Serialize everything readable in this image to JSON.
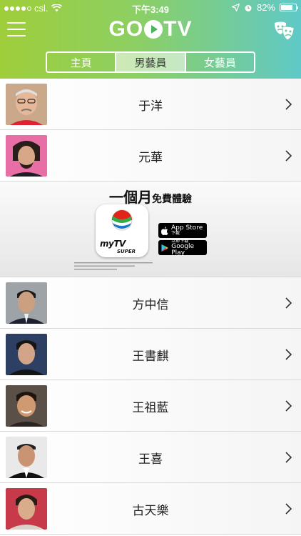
{
  "status_bar": {
    "carrier": "csl.",
    "time": "下午3:49",
    "battery_pct": "82%",
    "battery_level": 0.82
  },
  "nav": {
    "logo_left": "GO",
    "logo_right": "TV",
    "menu_icon": "hamburger-icon",
    "right_icon": "theater-masks-icon"
  },
  "tabs": [
    {
      "label": "主頁",
      "active": false
    },
    {
      "label": "男藝員",
      "active": true
    },
    {
      "label": "女藝員",
      "active": false
    }
  ],
  "artists_top": [
    {
      "name": "于洋"
    },
    {
      "name": "元華"
    }
  ],
  "ad": {
    "title_main": "一個月",
    "title_small": "免費體驗",
    "app_name": "myTV",
    "app_sub": "SUPER",
    "app_store_main": "App Store",
    "app_store_small": "下載",
    "google_play_small": "立即下載",
    "google_play_main": "Google Play"
  },
  "artists_bottom": [
    {
      "name": "方中信"
    },
    {
      "name": "王書麒"
    },
    {
      "name": "王祖藍"
    },
    {
      "name": "王喜"
    },
    {
      "name": "古天樂"
    }
  ],
  "colors": {
    "gradient_start": "#9fce3a",
    "gradient_end": "#5fc9c7",
    "tvb_red": "#e2231a",
    "tvb_green": "#2eae48",
    "tvb_blue": "#1a77c9"
  }
}
